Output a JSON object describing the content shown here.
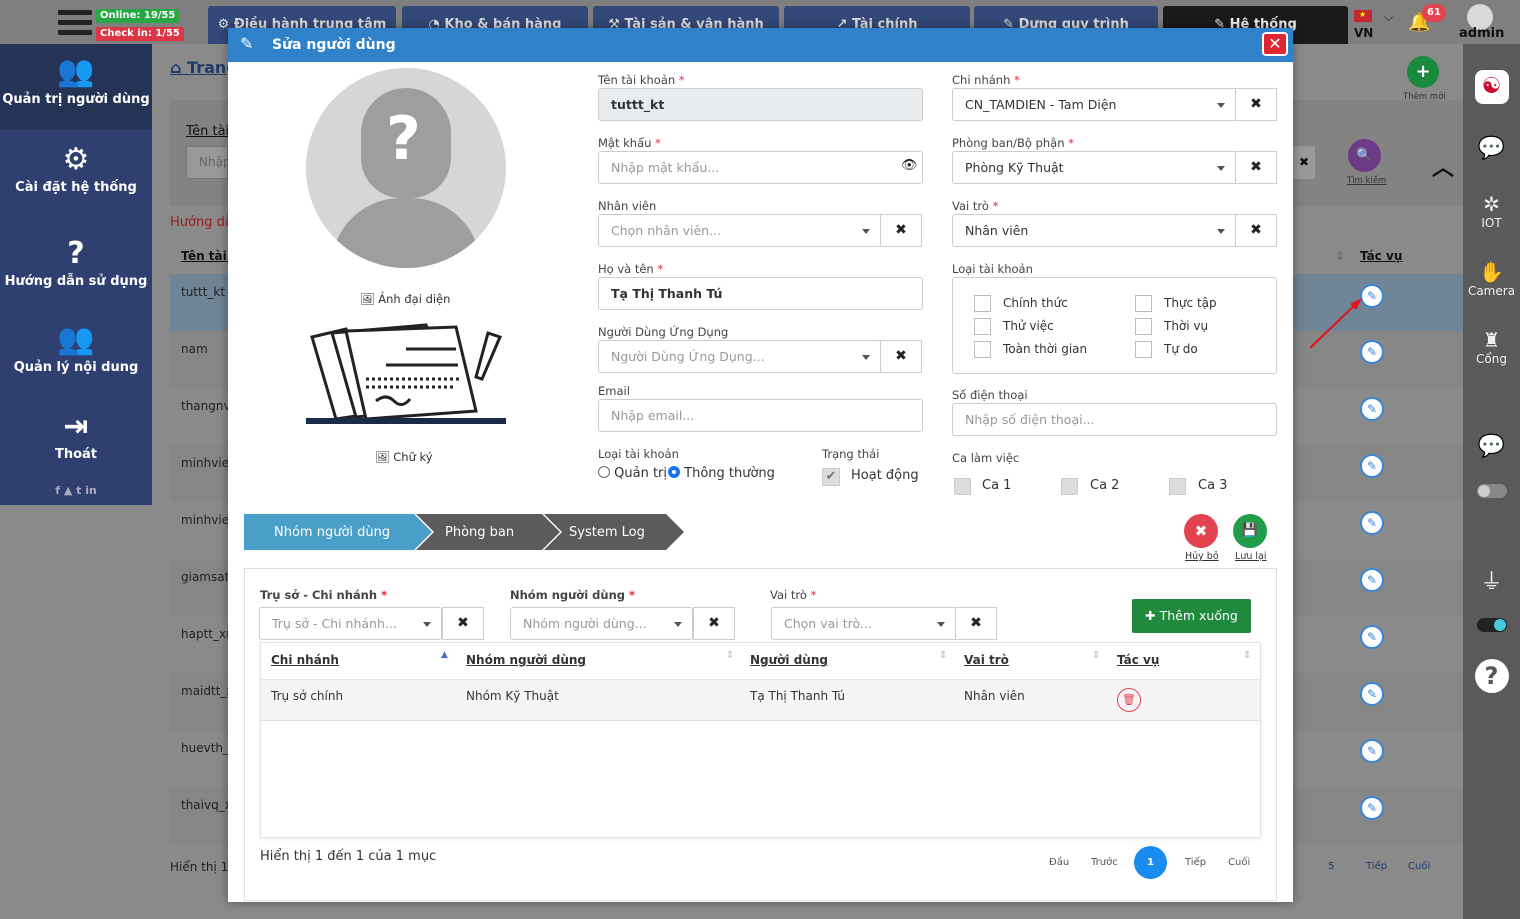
{
  "topbar": {
    "online": "Online: 19/55",
    "checkin": "Check in: 1/55",
    "tabs": [
      "Điều hành trung tâm",
      "Kho & bán hàng",
      "Tài sản & vận hành",
      "Tài chính",
      "Dựng quy trình",
      "Hệ thống"
    ],
    "lang": "VN",
    "notif_count": "61",
    "user": "admin"
  },
  "sidebar": {
    "items": [
      "Quản trị người dùng",
      "Cài đặt hệ thống",
      "Hướng dẫn sử dụng",
      "Quản lý nội dung",
      "Thoát"
    ],
    "social": "f ▲ t in"
  },
  "rightbar": {
    "items": [
      "",
      "",
      "IOT",
      "Camera",
      "Cổng",
      "",
      "",
      "",
      "",
      ""
    ]
  },
  "background": {
    "breadcrumb": "Trang",
    "filter_label": "Tên tài",
    "filter_placeholder": "Nhập",
    "guide": "Hướng dẫ",
    "col_name": "Tên tài k",
    "col_action": "Tác vụ",
    "add_new": "Thêm mới",
    "search": "Tìm kiếm",
    "rows": [
      "tuttt_kt",
      "nam",
      "thangnv",
      "minhvie",
      "minhvie",
      "giamsat",
      "haptt_xr",
      "maidtt_x",
      "huevth_",
      "thaivq_x"
    ],
    "footer": "Hiển thị 1",
    "pager": [
      "5",
      "Tiếp",
      "Cuối"
    ]
  },
  "modal": {
    "title": "Sửa người dùng",
    "avatar_label": "Ảnh đại diện",
    "signature_label": "Chữ ký",
    "account_label": "Tên tài khoản",
    "account_value": "tuttt_kt",
    "password_label": "Mật khẩu",
    "password_ph": "Nhập mật khẩu...",
    "employee_label": "Nhân viên",
    "employee_ph": "Chọn nhân viên...",
    "fullname_label": "Họ và tên",
    "fullname_value": "Tạ Thị Thanh Tú",
    "appuser_label": "Người Dùng Ứng Dụng",
    "appuser_ph": "Người Dùng Ứng Dụng...",
    "email_label": "Email",
    "email_ph": "Nhập email...",
    "acctype_label": "Loại tài khoản",
    "acctype_options": [
      "Quản trị",
      "Thông thường"
    ],
    "status_label": "Trạng thái",
    "status_value": "Hoạt động",
    "branch_label": "Chi nhánh",
    "branch_value": "CN_TAMDIEN - Tam Diện",
    "dept_label": "Phòng ban/Bộ phận",
    "dept_value": "Phòng Kỹ Thuật",
    "role_label": "Vai trò",
    "role_value": "Nhân viên",
    "acctype2_label": "Loại tài khoản",
    "acctype2_options": [
      "Chính thức",
      "Thực tập",
      "Thử việc",
      "Thời vụ",
      "Toàn thời gian",
      "Tự do"
    ],
    "phone_label": "Số điện thoại",
    "phone_ph": "Nhập số điện thoại...",
    "shift_label": "Ca làm việc",
    "shifts": [
      "Ca 1",
      "Ca 2",
      "Ca 3"
    ],
    "steps": [
      "Nhóm người dùng",
      "Phòng ban",
      "System Log"
    ],
    "cancel": "Hủy bỏ",
    "save": "Lưu lại",
    "sub_branch_label": "Trụ sở - Chi nhánh",
    "sub_branch_ph": "Trụ sở - Chi nhánh...",
    "sub_group_label": "Nhóm người dùng",
    "sub_group_ph": "Nhóm người dùng...",
    "sub_role_label": "Vai trò",
    "sub_role_ph": "Chọn vai trò...",
    "add_below": "Thêm xuống",
    "table_headers": [
      "Chi nhánh",
      "Nhóm người dùng",
      "Người dùng",
      "Vai trò",
      "Tác vụ"
    ],
    "table_rows": [
      [
        "Trụ sở chính",
        "Nhóm Kỹ Thuật",
        "Tạ Thị Thanh Tú",
        "Nhân viên"
      ]
    ],
    "table_info": "Hiển thị 1 đến 1 của 1 mục",
    "pager": [
      "Đầu",
      "Trước",
      "1",
      "Tiếp",
      "Cuối"
    ]
  },
  "colors": {
    "primary": "#2f82c9",
    "sidebar": "#2f4070",
    "danger": "#e2434e",
    "success": "#1f9d48"
  }
}
